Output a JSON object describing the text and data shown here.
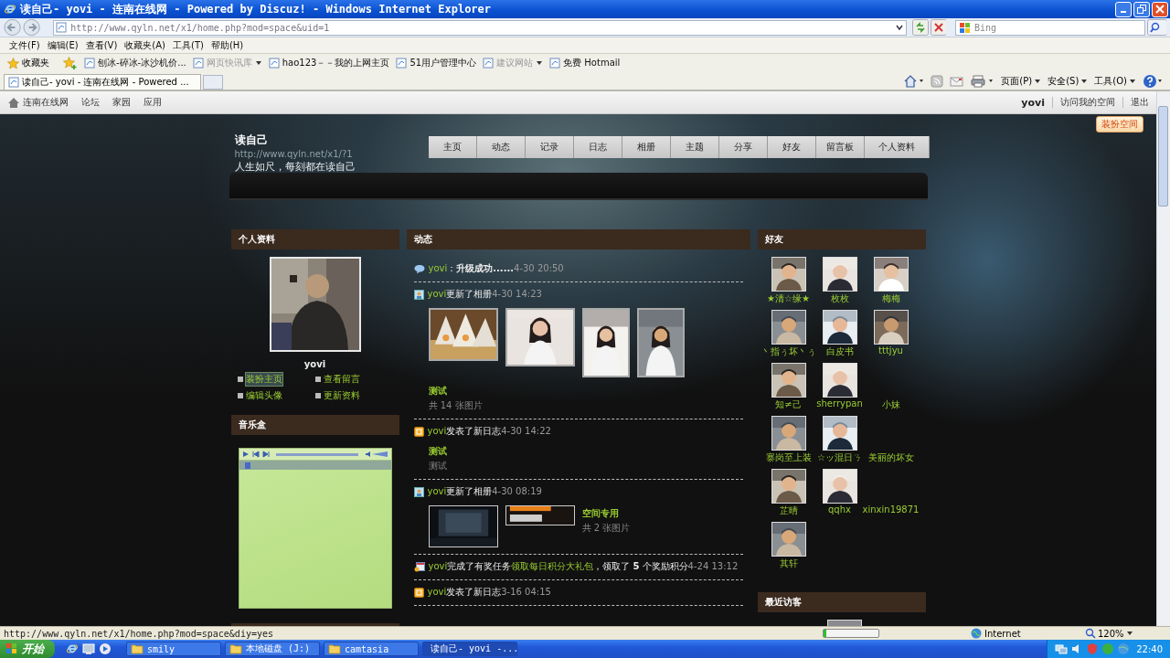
{
  "browser": {
    "title": "读自己- yovi - 连南在线网 - Powered by Discuz! - Windows Internet Explorer",
    "address": "http://www.qyln.net/x1/home.php?mod=space&uid=1",
    "search_placeholder": "Bing",
    "menu": [
      "文件(F)",
      "编辑(E)",
      "查看(V)",
      "收藏夹(A)",
      "工具(T)",
      "帮助(H)"
    ],
    "favorites_button": "收藏夹",
    "favorites": [
      {
        "label": "刨冰-碎冰-冰沙机价...",
        "dimmed": false,
        "dropdown": false
      },
      {
        "label": "网页快讯库",
        "dimmed": true,
        "dropdown": true
      },
      {
        "label": "hao123－－我的上网主页",
        "dimmed": false,
        "dropdown": false
      },
      {
        "label": "51用户管理中心",
        "dimmed": false,
        "dropdown": false
      },
      {
        "label": "建议网站",
        "dimmed": true,
        "dropdown": true
      },
      {
        "label": "免费 Hotmail",
        "dimmed": false,
        "dropdown": false
      }
    ],
    "tabs": [
      {
        "label": "读自己- yovi - 连南在线网 - Powered ...",
        "selected": true
      }
    ],
    "commands": [
      "页面(P)",
      "安全(S)",
      "工具(O)"
    ]
  },
  "site_bar": {
    "links": [
      "连南在线网",
      "论坛",
      "家园",
      "应用"
    ],
    "user": "yovi",
    "account_links": [
      "访问我的空间",
      "退出"
    ]
  },
  "space": {
    "title": "读自己",
    "url": "http://www.qyln.net/x1/?1",
    "motto": "人生如尺，每刻都在读自己",
    "dress_button": "装扮空间",
    "nav": [
      {
        "label": "主页",
        "selected": false
      },
      {
        "label": "动态",
        "selected": false
      },
      {
        "label": "记录",
        "selected": false
      },
      {
        "label": "日志",
        "selected": false
      },
      {
        "label": "相册",
        "selected": false
      },
      {
        "label": "主题",
        "selected": false
      },
      {
        "label": "分享",
        "selected": false
      },
      {
        "label": "好友",
        "selected": false
      },
      {
        "label": "留言板",
        "selected": false
      },
      {
        "label": "个人资料",
        "selected": false
      }
    ]
  },
  "profile": {
    "header": "个人资料",
    "name": "yovi",
    "links": [
      "装扮主页",
      "查看留言",
      "编辑头像",
      "更新资料"
    ]
  },
  "music": {
    "header": "音乐盒"
  },
  "feed": {
    "header": "动态",
    "items": [
      {
        "kind": "status",
        "user": "yovi",
        "text": "：**升级成功......**",
        "time": "4-30 20:50"
      },
      {
        "kind": "album",
        "user": "yovi",
        "action": "更新了相册",
        "time": "4-30 14:23",
        "title": "测试",
        "caption": "共 14 张图片"
      },
      {
        "kind": "blog",
        "user": "yovi",
        "action": "发表了新日志",
        "time": "4-30 14:22",
        "title": "测试",
        "summary": "测试"
      },
      {
        "kind": "album_inline",
        "user": "yovi",
        "action": "更新了相册",
        "time": "4-30 08:19",
        "title": "空间专用",
        "caption": "共 2 张图片"
      },
      {
        "kind": "task",
        "user": "yovi",
        "action": "完成了有奖任务",
        "link": "领取每日积分大礼包",
        "text": "，领取了 **5** 个奖励积分",
        "time": "4-24 13:12"
      },
      {
        "kind": "blog",
        "user": "yovi",
        "action": "发表了新日志",
        "time": "3-16 04:15"
      }
    ]
  },
  "friends": {
    "header": "好友",
    "list": [
      {
        "name": "★清☆缘★",
        "has_avatar": true
      },
      {
        "name": "枚枚",
        "has_avatar": true
      },
      {
        "name": "梅梅",
        "has_avatar": true
      },
      {
        "name": "丶指ぅ坏丶ぅ",
        "has_avatar": true
      },
      {
        "name": "白皮书",
        "has_avatar": true
      },
      {
        "name": "tttjyu",
        "has_avatar": true
      },
      {
        "name": "知≠己",
        "has_avatar": true
      },
      {
        "name": "sherrypan",
        "has_avatar": true
      },
      {
        "name": "小妹",
        "has_avatar": false
      },
      {
        "name": "寨岗至上装",
        "has_avatar": true
      },
      {
        "name": "☆ッ混日ㄋ",
        "has_avatar": true
      },
      {
        "name": "美丽的坏女",
        "has_avatar": false
      },
      {
        "name": "芷晴",
        "has_avatar": true
      },
      {
        "name": "qqhx",
        "has_avatar": true
      },
      {
        "name": "xinxin19871",
        "has_avatar": false
      },
      {
        "name": "其轩",
        "has_avatar": true
      }
    ]
  },
  "visitors": {
    "header": "最近访客"
  },
  "status_bar": {
    "url": "http://www.qyln.net/x1/home.php?mod=space&diy=yes",
    "progress": {
      "level": 0.05
    },
    "zone": "Internet",
    "zoom": "120%"
  },
  "taskbar": {
    "start": "开始",
    "tasks": [
      {
        "label": "smily",
        "kind": "folder",
        "selected": false
      },
      {
        "label": "本地磁盘 (J:)",
        "kind": "folder",
        "selected": false
      },
      {
        "label": "camtasia",
        "kind": "folder",
        "selected": false
      },
      {
        "label": "读自己- yovi -...",
        "kind": "browser",
        "selected": true
      }
    ],
    "time": "22:40"
  }
}
